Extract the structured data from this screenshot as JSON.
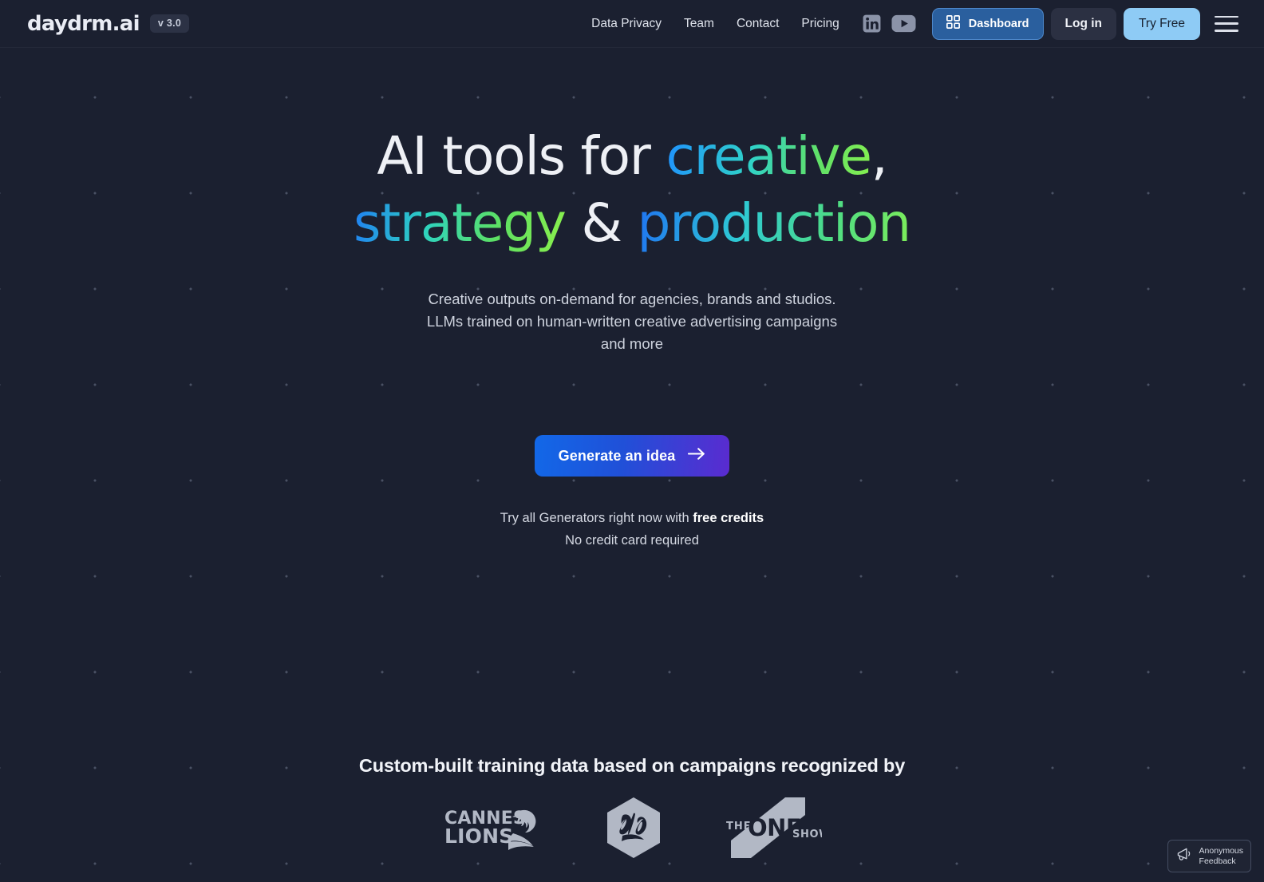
{
  "header": {
    "logo_text": "daydrm.ai",
    "version_badge": "v 3.0",
    "nav_links": [
      {
        "label": "Data Privacy"
      },
      {
        "label": "Team"
      },
      {
        "label": "Contact"
      },
      {
        "label": "Pricing"
      }
    ],
    "social": [
      {
        "name": "linkedin-icon",
        "label": "in"
      },
      {
        "name": "youtube-icon",
        "label": "YouTube"
      }
    ],
    "dashboard_label": "Dashboard",
    "login_label": "Log in",
    "tryfree_label": "Try Free",
    "menu_label": "Menu"
  },
  "hero": {
    "headline": {
      "line1_plain": "AI tools for ",
      "line1_accent": "creative",
      "line1_comma": ",",
      "line2_accent_a": "strategy",
      "line2_amp": " & ",
      "line2_accent_b": "production"
    },
    "subhead": "Creative outputs on-demand for agencies, brands and studios. LLMs trained on human-written creative advertising campaigns and more",
    "cta_label": "Generate an idea",
    "cta_sub_line1_pre": "Try all Generators right now with ",
    "cta_sub_line1_bold": "free credits",
    "cta_sub_line2": "No credit card required"
  },
  "awards": {
    "title": "Custom-built training data based on campaigns recognized by",
    "logos": [
      {
        "name": "cannes-lions-logo",
        "line1": "CANNES",
        "line2": "LIONS"
      },
      {
        "name": "dand-ad-logo",
        "text": "D&AD"
      },
      {
        "name": "one-show-logo",
        "the": "THE",
        "one": "ONE",
        "show": "SHOW"
      }
    ]
  },
  "feedback_widget": {
    "line1": "Anonymous",
    "line2": "Feedback"
  },
  "colors": {
    "page_bg": "#1b2030",
    "accent_blue": "#1f8fff",
    "accent_green": "#86ef4e",
    "dashboard_blue": "#2a5f9e",
    "tryfree_blue": "#8ecbf5",
    "cta_gradient_start": "#1268e8",
    "cta_gradient_end": "#5a2bd0"
  }
}
